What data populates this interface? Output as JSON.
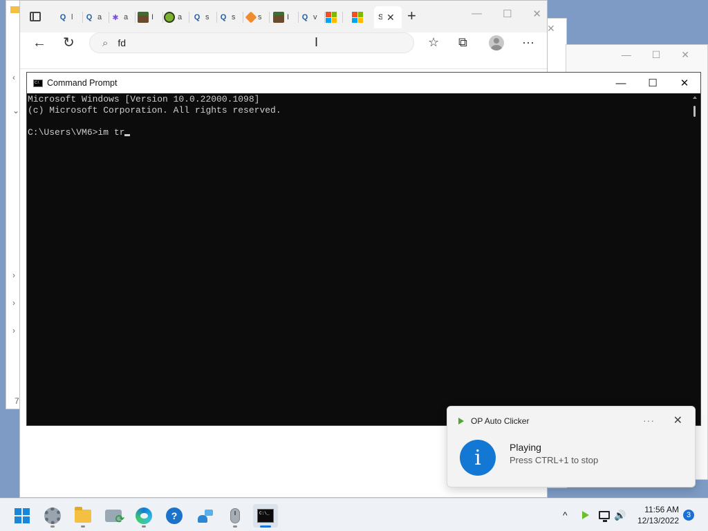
{
  "browser": {
    "tabs": [
      {
        "icon": "search-icon",
        "text": "l"
      },
      {
        "icon": "search-icon",
        "text": "a"
      },
      {
        "icon": "cursor-click-icon",
        "text": "a"
      },
      {
        "icon": "minecraft-icon",
        "text": "I"
      },
      {
        "icon": "globe-badge-icon",
        "text": "a"
      },
      {
        "icon": "search-icon",
        "text": "s"
      },
      {
        "icon": "search-icon",
        "text": "s"
      },
      {
        "icon": "diamond-icon",
        "text": "s"
      },
      {
        "icon": "minecraft-icon",
        "text": "I"
      },
      {
        "icon": "search-icon",
        "text": "v"
      },
      {
        "icon": "microsoft-logo-icon",
        "text": ""
      },
      {
        "icon": "microsoft-logo-icon",
        "text": ""
      }
    ],
    "active_tab": {
      "text": "S",
      "close": "✕"
    },
    "new_tab": "+",
    "window_controls": {
      "minimize": "—",
      "maximize": "☐",
      "close": "✕"
    },
    "address_value": "fd"
  },
  "background": {
    "left_glyphs": [
      {
        "text": "‹"
      },
      {
        "text": "⌄"
      },
      {
        "text": "›"
      },
      {
        "text": "›"
      },
      {
        "text": "›"
      },
      {
        "text": "7"
      }
    ],
    "right_close": "✕",
    "right2_controls": {
      "minimize": "—",
      "maximize": "☐",
      "close": "✕"
    }
  },
  "cmd": {
    "title": "Command Prompt",
    "controls": {
      "minimize": "—",
      "maximize": "☐",
      "close": "✕"
    },
    "lines": [
      "Microsoft Windows [Version 10.0.22000.1098]",
      "(c) Microsoft Corporation. All rights reserved.",
      "",
      "C:\\Users\\VM6>im tr"
    ]
  },
  "toast": {
    "app": "OP Auto Clicker",
    "more": "···",
    "close": "✕",
    "icon": "info-icon",
    "info_glyph": "i",
    "title": "Playing",
    "body": "Press CTRL+1 to stop"
  },
  "taskbar": {
    "apps": [
      "start",
      "settings",
      "file-explorer",
      "sync-app",
      "edge",
      "get-help",
      "quick-assist",
      "mouse-app",
      "command-prompt"
    ],
    "active_app": "command-prompt",
    "tray": {
      "chevron": "^",
      "volume": "🔊",
      "time": "11:56 AM",
      "date": "12/13/2022",
      "notifications": "3"
    }
  },
  "colors": {
    "accent": "#1a73d8",
    "console_bg": "#0c0c0c",
    "console_fg": "#cccccc",
    "info_blue": "#1377d4",
    "play_green": "#4ea72e"
  }
}
